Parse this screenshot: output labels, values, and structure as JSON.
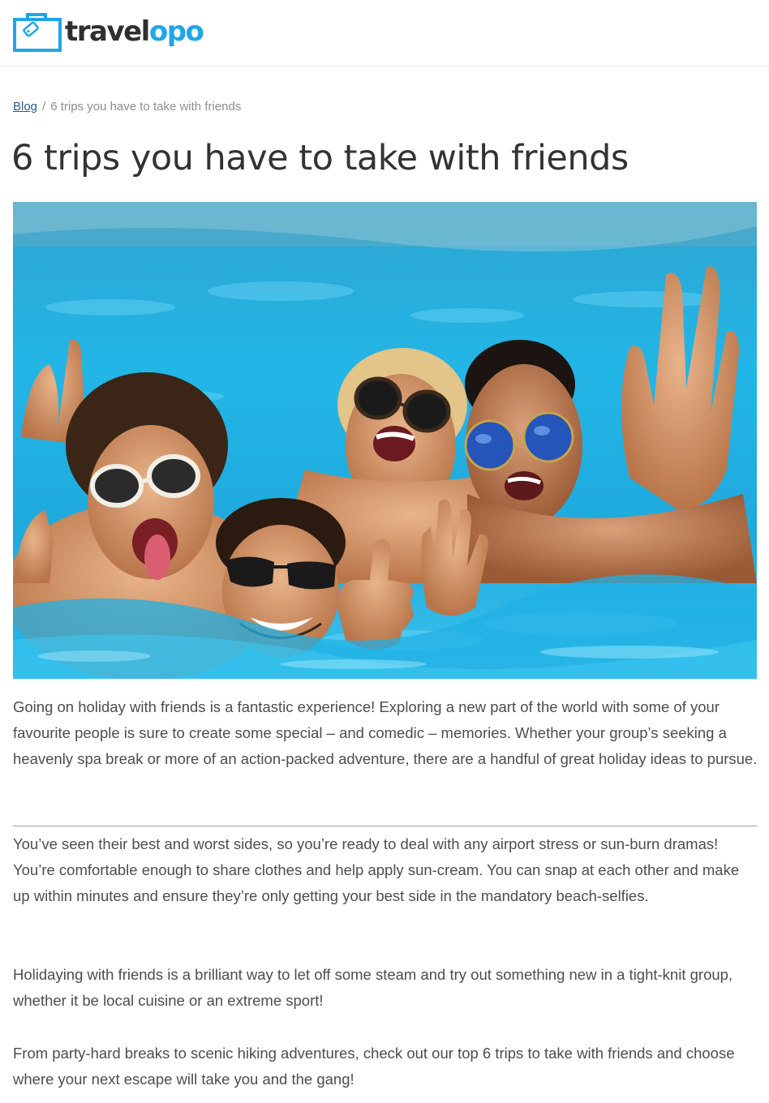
{
  "header": {
    "logo_text_1": "travel",
    "logo_text_2": "opo",
    "logo_icon": "suitcase-tag-icon",
    "brand_color": "#1fa6e8"
  },
  "breadcrumb": {
    "link": "Blog",
    "separator": "/",
    "current": "6 trips you have to take with friends"
  },
  "article": {
    "title": "6 trips you have to take with friends",
    "hero_image": "friends-in-pool-photo",
    "paragraphs": [
      "Going on holiday with friends is a fantastic experience! Exploring a new part of the world with some of your favourite people is sure to create some special – and comedic – memories. Whether your group’s seeking a heavenly spa break or more of an action-packed adventure, there are a handful of great holiday ideas to pursue.",
      "You’ve seen their best and worst sides, so you’re ready to deal with any airport stress or sun-burn dramas! You’re comfortable enough to share clothes and help apply sun-cream. You can snap at each other and make up within minutes and ensure they’re only getting your best side in the mandatory beach-selfies.",
      "Holidaying with friends is a brilliant way to let off some steam and try out something new in a tight-knit group, whether it be local cuisine or an extreme sport!",
      "From party-hard breaks to scenic hiking adventures, check out our top 6 trips to take with friends and choose where your next escape will take you and the gang!"
    ]
  }
}
